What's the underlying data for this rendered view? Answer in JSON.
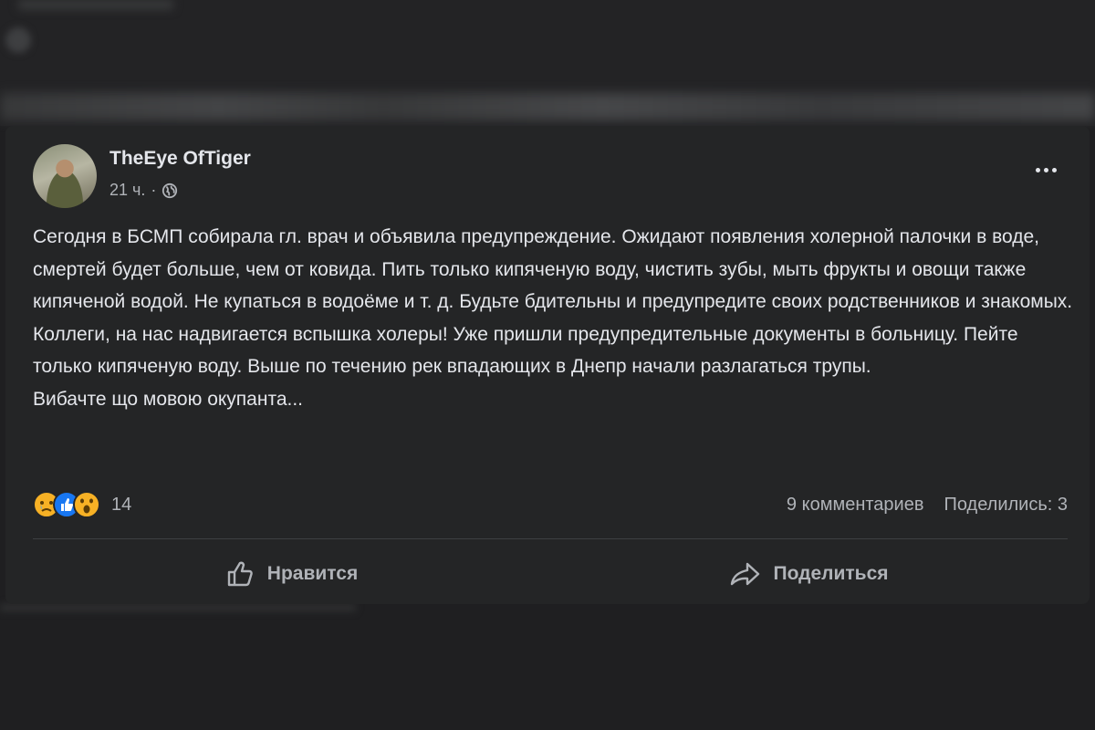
{
  "post": {
    "author": "TheEye OfTiger",
    "time": "21 ч.",
    "separator": "·",
    "privacy_icon": "globe-icon",
    "more_icon": "more-options-icon",
    "paragraphs": [
      "Сегодня в БСМП собирала гл. врач и объявила предупреждение. Ожидают появления холерной палочки в воде, смертей будет больше, чем от ковида. Пить только кипяченую воду, чистить зубы, мыть фрукты и овощи также кипяченой водой. Не купаться в водоёме и т. д. Будьте бдительны и предупредите своих родственников и знакомых.",
      "Коллеги, на нас надвигается вспышка холеры! Уже пришли предупредительные документы в больницу. Пейте только кипяченую воду. Выше по течению рек впадающих в Днепр начали разлагаться трупы.",
      "Вибачте що мовою окупанта..."
    ]
  },
  "reactions": {
    "icons": [
      "sad-reaction-icon",
      "like-reaction-icon",
      "wow-reaction-icon"
    ],
    "count": "14"
  },
  "stats": {
    "comments": "9 комментариев",
    "shares": "Поделились: 3"
  },
  "actions": {
    "like_label": "Нравится",
    "share_label": "Поделиться"
  },
  "colors": {
    "background": "#1f1f21",
    "card": "#242526",
    "primary_text": "#e4e6eb",
    "secondary_text": "#b0b3b8",
    "like_blue": "#1877f2",
    "reaction_yellow": "#f7b125"
  }
}
